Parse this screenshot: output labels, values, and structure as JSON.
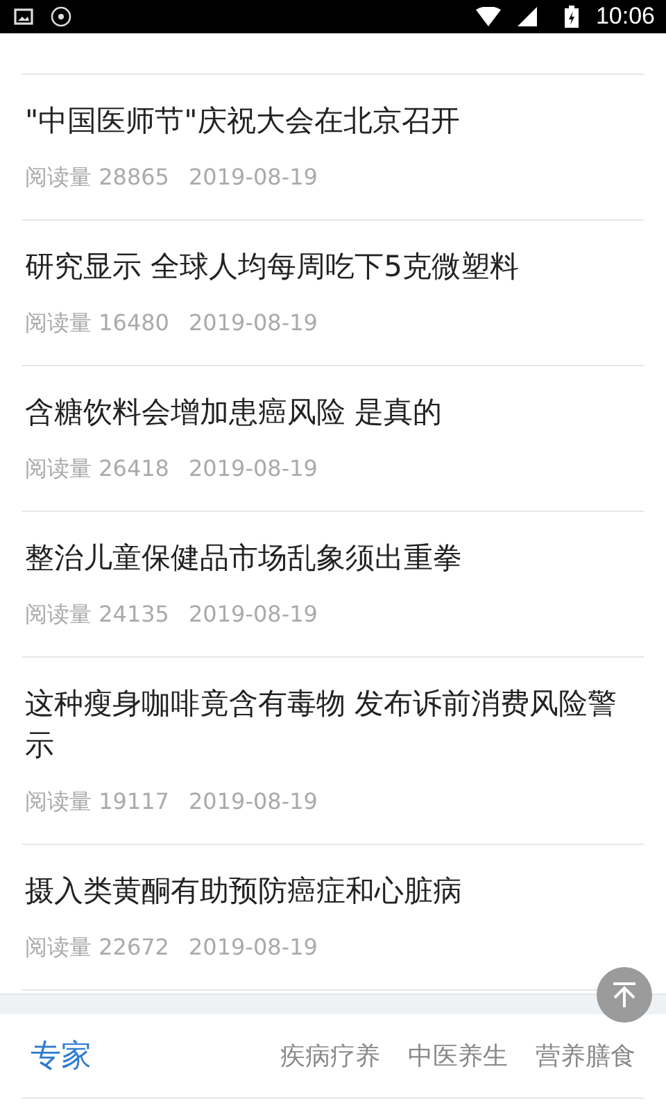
{
  "status_bar": {
    "time": "10:06"
  },
  "articles": [
    {
      "title": "\"中国医师节\"庆祝大会在北京召开",
      "reads": "阅读量 28865",
      "date": "2019-08-19"
    },
    {
      "title": "研究显示 全球人均每周吃下5克微塑料",
      "reads": "阅读量 16480",
      "date": "2019-08-19"
    },
    {
      "title": "含糖饮料会增加患癌风险 是真的",
      "reads": "阅读量 26418",
      "date": "2019-08-19"
    },
    {
      "title": "整治儿童保健品市场乱象须出重拳",
      "reads": "阅读量 24135",
      "date": "2019-08-19"
    },
    {
      "title": "这种瘦身咖啡竟含有毒物 发布诉前消费风险警示",
      "reads": "阅读量 19117",
      "date": "2019-08-19"
    },
    {
      "title": "摄入类黄酮有助预防癌症和心脏病",
      "reads": "阅读量 22672",
      "date": "2019-08-19"
    }
  ],
  "expert_section": {
    "title": "专家",
    "tabs": [
      "疾病疗养",
      "中医养生",
      "营养膳食"
    ]
  }
}
